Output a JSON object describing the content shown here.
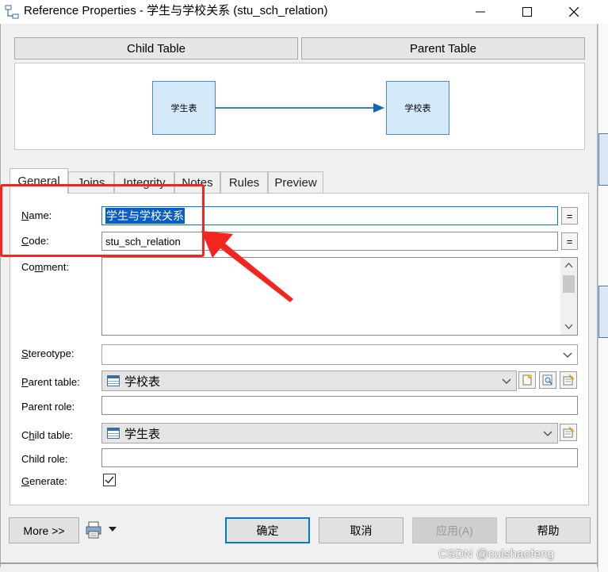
{
  "window": {
    "title": "Reference Properties - 学生与学校关系 (stu_sch_relation)"
  },
  "diagram": {
    "child_header": "Child Table",
    "parent_header": "Parent Table",
    "child_box": "学生表",
    "parent_box": "学校表"
  },
  "tabs": [
    {
      "label": "General",
      "active": true
    },
    {
      "label": "Joins"
    },
    {
      "label": "Integrity"
    },
    {
      "label": "Notes"
    },
    {
      "label": "Rules"
    },
    {
      "label": "Preview"
    }
  ],
  "form": {
    "name_label_key": "N",
    "name_label_rest": "ame:",
    "name_value": "学生与学校关系",
    "code_label_key": "C",
    "code_label_rest": "ode:",
    "code_value": "stu_sch_relation",
    "eq_label": "=",
    "comment_label_key": "Co",
    "comment_label_key_u": "m",
    "comment_label_rest": "ment:",
    "stereotype_label_key": "S",
    "stereotype_label_rest": "tereotype:",
    "stereotype_value": "",
    "parent_table_label_key": "P",
    "parent_table_label_rest": "arent table:",
    "parent_table_value": "学校表",
    "parent_role_label": "Parent role:",
    "child_table_label_pre": "C",
    "child_table_label_key": "h",
    "child_table_label_rest": "ild table:",
    "child_table_value": "学生表",
    "child_role_label": "Child role:",
    "generate_label_key": "G",
    "generate_label_rest": "enerate:",
    "generate_checked": true
  },
  "buttons": {
    "more": "More >>",
    "ok": "确定",
    "cancel": "取消",
    "apply": "应用(A)",
    "help": "帮助"
  },
  "watermark": "CSDN @cuishaofeng",
  "colors": {
    "annotation_red": "#f3261f",
    "selection_blue": "#0a5dc2",
    "table_box_fill": "#d5eaf8"
  }
}
